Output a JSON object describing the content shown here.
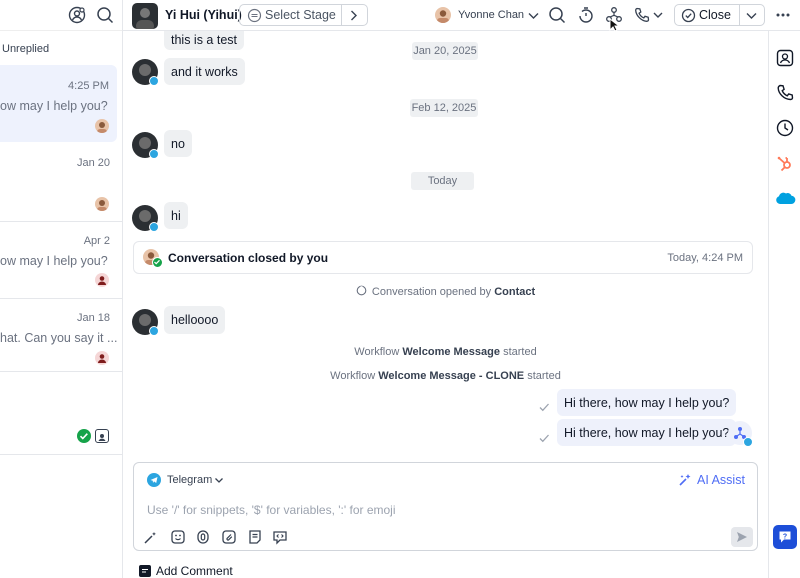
{
  "left_panel": {
    "filter_label": "Unreplied",
    "conversations": [
      {
        "time": "4:25 PM",
        "preview": "ow may I help you?"
      },
      {
        "time": "Jan 20",
        "preview": ""
      },
      {
        "time": "Apr 2",
        "preview": "ow may I help you?"
      },
      {
        "time": "Jan 18",
        "preview": "hat. Can you say it ..."
      }
    ]
  },
  "header": {
    "contact_name": "Yi Hui (Yihui)",
    "stage_label": "Select Stage",
    "assignee": "Yvonne Chan",
    "close_label": "Close"
  },
  "messages": {
    "m1": "this is a test",
    "m2": "and it works",
    "date1": "Jan 20, 2025",
    "date2": "Feb 12, 2025",
    "m3": "no",
    "date3": "Today",
    "m4": "hi",
    "closed_label": "Conversation closed by you",
    "closed_time": "Today, 4:24 PM",
    "opened_prefix": "Conversation opened by",
    "opened_by": "Contact",
    "m5": "helloooo",
    "wf1_prefix": "Workflow",
    "wf1_name": "Welcome Message",
    "wf1_suffix": "started",
    "wf2_prefix": "Workflow",
    "wf2_name": "Welcome Message - CLONE",
    "wf2_suffix": "started",
    "out1": "Hi there, how may I help you?",
    "out2": "Hi there, how may I help you?"
  },
  "composer": {
    "channel": "Telegram",
    "ai_assist": "AI Assist",
    "placeholder": "Use '/' for snippets, '$' for variables, ':' for emoji"
  },
  "footer": {
    "add_comment": "Add Comment"
  },
  "colors": {
    "accent": "#4f6df5",
    "telegram": "#2ca5e0",
    "hubspot": "#ff7a59",
    "salesforce": "#00a1e0"
  }
}
